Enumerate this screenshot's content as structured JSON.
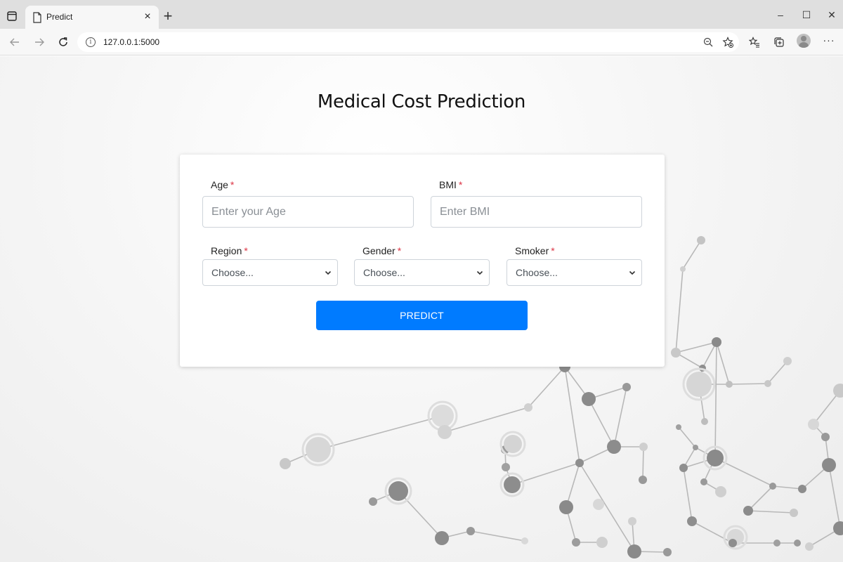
{
  "browser": {
    "tab_title": "Predict",
    "tab_close": "×",
    "new_tab": "+",
    "url": "127.0.0.1:5000",
    "window_controls": {
      "minimize": "–",
      "maximize": "☐",
      "close": "✕"
    },
    "more_menu": "···",
    "icons": [
      "tab-actions-icon",
      "document-icon",
      "back-arrow-icon",
      "forward-arrow-icon",
      "refresh-icon",
      "info-icon",
      "zoom-out-icon",
      "add-favorite-icon",
      "favorites-icon",
      "collections-icon",
      "profile-avatar"
    ]
  },
  "page": {
    "title": "Medical Cost Prediction",
    "form": {
      "age": {
        "label": "Age",
        "required_mark": "*",
        "placeholder": "Enter your Age"
      },
      "bmi": {
        "label": "BMI",
        "required_mark": "*",
        "placeholder": "Enter BMI"
      },
      "region": {
        "label": "Region",
        "required_mark": "*",
        "value": "Choose..."
      },
      "gender": {
        "label": "Gender",
        "required_mark": "*",
        "value": "Choose..."
      },
      "smoker": {
        "label": "Smoker",
        "required_mark": "*",
        "value": "Choose..."
      },
      "submit_label": "PREDICT"
    }
  },
  "colors": {
    "primary_button": "#007bff",
    "required_mark": "#dc3545",
    "molecule_nodes": "#888888"
  }
}
